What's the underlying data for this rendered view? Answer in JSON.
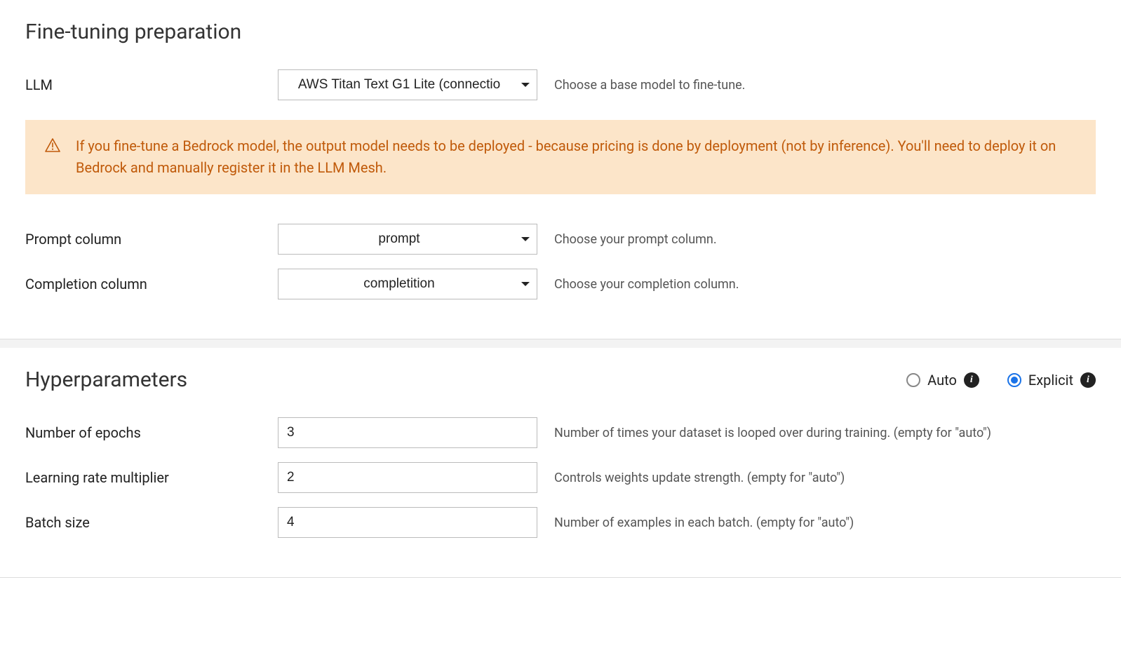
{
  "section1": {
    "title": "Fine-tuning preparation",
    "llm": {
      "label": "LLM",
      "value": "AWS Titan Text G1 Lite (connectio",
      "help": "Choose a base model to fine-tune."
    },
    "alert": "If you fine-tune a Bedrock model, the output model needs to be deployed - because pricing is done by deployment (not by inference). You'll need to deploy it on Bedrock and manually register it in the LLM Mesh.",
    "prompt_col": {
      "label": "Prompt column",
      "value": "prompt",
      "help": "Choose your prompt column."
    },
    "completion_col": {
      "label": "Completion column",
      "value": "completition",
      "help": "Choose your completion column."
    }
  },
  "section2": {
    "title": "Hyperparameters",
    "mode": {
      "auto_label": "Auto",
      "explicit_label": "Explicit",
      "selected": "explicit"
    },
    "epochs": {
      "label": "Number of epochs",
      "value": "3",
      "help": "Number of times your dataset is looped over during training. (empty for \"auto\")"
    },
    "lr_mult": {
      "label": "Learning rate multiplier",
      "value": "2",
      "help": "Controls weights update strength. (empty for \"auto\")"
    },
    "batch": {
      "label": "Batch size",
      "value": "4",
      "help": "Number of examples in each batch. (empty for \"auto\")"
    }
  }
}
